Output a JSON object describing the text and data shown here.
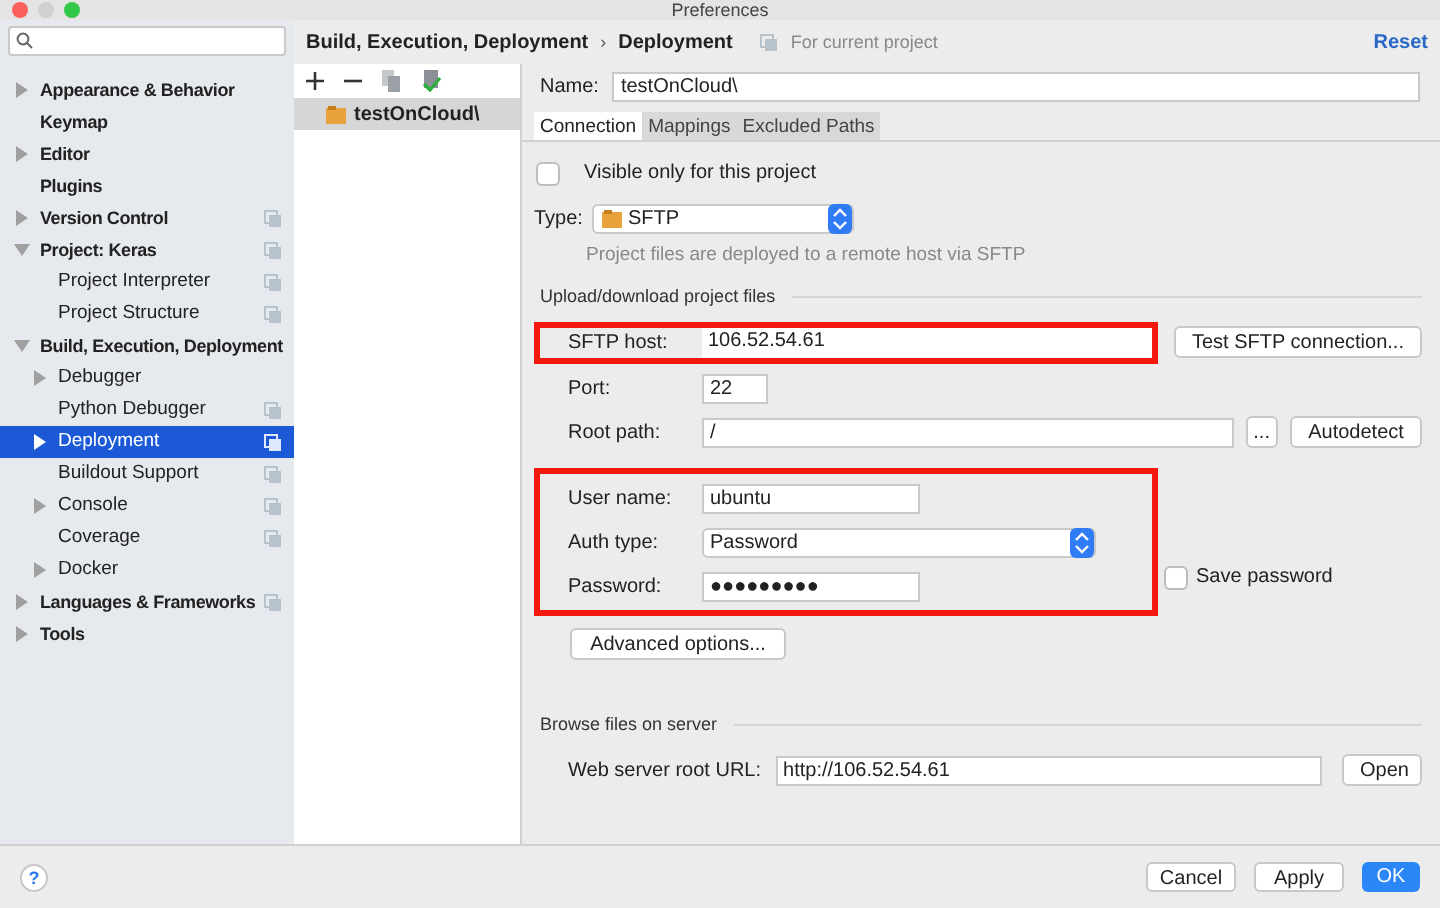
{
  "window": {
    "title": "Preferences"
  },
  "sidebar": {
    "items": [
      {
        "label": "Appearance & Behavior",
        "kind": "folder",
        "expanded": false,
        "project_scope": false,
        "selected": false
      },
      {
        "label": "Keymap",
        "kind": "leaf",
        "project_scope": false,
        "selected": false
      },
      {
        "label": "Editor",
        "kind": "folder",
        "expanded": false,
        "project_scope": false,
        "selected": false
      },
      {
        "label": "Plugins",
        "kind": "leaf",
        "project_scope": false,
        "selected": false
      },
      {
        "label": "Version Control",
        "kind": "folder",
        "expanded": false,
        "project_scope": true,
        "selected": false
      },
      {
        "label": "Project: Keras",
        "kind": "folder",
        "expanded": true,
        "project_scope": true,
        "selected": false,
        "children": [
          {
            "label": "Project Interpreter",
            "kind": "leaf",
            "project_scope": true,
            "selected": false
          },
          {
            "label": "Project Structure",
            "kind": "leaf",
            "project_scope": true,
            "selected": false
          }
        ]
      },
      {
        "label": "Build, Execution, Deployment",
        "kind": "folder",
        "expanded": true,
        "project_scope": false,
        "selected": false,
        "children": [
          {
            "label": "Debugger",
            "kind": "folder",
            "expanded": false,
            "project_scope": false,
            "selected": false
          },
          {
            "label": "Python Debugger",
            "kind": "leaf",
            "project_scope": true,
            "selected": false
          },
          {
            "label": "Deployment",
            "kind": "folder",
            "expanded": false,
            "project_scope": true,
            "selected": true
          },
          {
            "label": "Buildout Support",
            "kind": "leaf",
            "project_scope": true,
            "selected": false
          },
          {
            "label": "Console",
            "kind": "folder",
            "expanded": false,
            "project_scope": true,
            "selected": false
          },
          {
            "label": "Coverage",
            "kind": "leaf",
            "project_scope": true,
            "selected": false
          },
          {
            "label": "Docker",
            "kind": "folder",
            "expanded": false,
            "project_scope": false,
            "selected": false
          }
        ]
      },
      {
        "label": "Languages & Frameworks",
        "kind": "folder",
        "expanded": false,
        "project_scope": true,
        "selected": false
      },
      {
        "label": "Tools",
        "kind": "folder",
        "expanded": false,
        "project_scope": false,
        "selected": false
      }
    ]
  },
  "breadcrumb": [
    "Build, Execution, Deployment",
    "Deployment"
  ],
  "breadcrumb_separator": "›",
  "scope_note": "For current project",
  "reset": "Reset",
  "servers": [
    {
      "label": "testOnCloud\\",
      "selected": true
    }
  ],
  "name": {
    "label": "Name:",
    "value": "testOnCloud\\"
  },
  "tabs": [
    {
      "label": "Connection",
      "selected": true
    },
    {
      "label": "Mappings",
      "selected": false
    },
    {
      "label": "Excluded Paths",
      "selected": false
    }
  ],
  "visible_only": {
    "label": "Visible only for this project",
    "checked": false
  },
  "type": {
    "label": "Type:",
    "value": "SFTP",
    "description": "Project files are deployed to a remote host via SFTP"
  },
  "upload_section": "Upload/download project files",
  "sftp_host": {
    "label": "SFTP host:",
    "value": "106.52.54.61",
    "highlighted": true
  },
  "test_button": "Test SFTP connection...",
  "port": {
    "label": "Port:",
    "value": "22"
  },
  "root_path": {
    "label": "Root path:",
    "value": "/",
    "browse": "...",
    "autodetect": "Autodetect"
  },
  "credentials": {
    "highlighted": true,
    "user_name": {
      "label": "User name:",
      "value": "ubuntu"
    },
    "auth_type": {
      "label": "Auth type:",
      "value": "Password"
    },
    "password": {
      "label": "Password:",
      "value": "●●●●●●●●●"
    },
    "save_password": {
      "label": "Save password",
      "checked": false
    }
  },
  "advanced_button": "Advanced options...",
  "browse_section": "Browse files on server",
  "web_root": {
    "label": "Web server root URL:",
    "value": "http://106.52.54.61",
    "open": "Open"
  },
  "footer": {
    "help": "?",
    "buttons": [
      {
        "label": "Cancel",
        "kind": "plain"
      },
      {
        "label": "Apply",
        "kind": "plain"
      },
      {
        "label": "OK",
        "kind": "default"
      }
    ]
  }
}
